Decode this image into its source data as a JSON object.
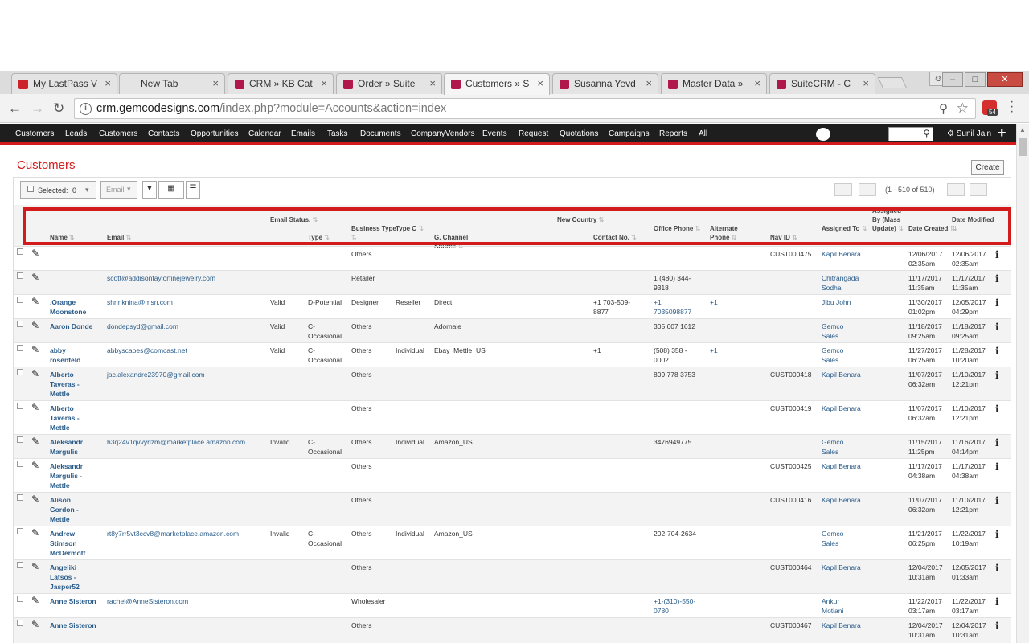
{
  "browser": {
    "tabs": [
      {
        "title": "My LastPass V",
        "fav": "lp",
        "active": false
      },
      {
        "title": "New Tab",
        "fav": "blank",
        "active": false
      },
      {
        "title": "CRM » KB Cat",
        "fav": "suite",
        "active": false
      },
      {
        "title": "Order » Suite",
        "fav": "suite",
        "active": false
      },
      {
        "title": "Customers » S",
        "fav": "suite",
        "active": true
      },
      {
        "title": "Susanna Yevd",
        "fav": "suite",
        "active": false
      },
      {
        "title": "Master Data »",
        "fav": "suite",
        "active": false
      },
      {
        "title": "SuiteCRM - C",
        "fav": "suite",
        "active": false
      }
    ],
    "url_host": "crm.gemcodesigns.com",
    "url_path": "/index.php?module=Accounts&action=index",
    "ext_badge": "54"
  },
  "nav": {
    "items": [
      "Customers",
      "Leads",
      "Customers",
      "Contacts",
      "Opportunities",
      "Calendar",
      "Emails",
      "Tasks",
      "Documents",
      "CompanyVendors",
      "Events",
      "Request",
      "Quotations",
      "Campaigns",
      "Reports",
      "All"
    ],
    "user": "Sunil Jain"
  },
  "page": {
    "title": "Customers",
    "create_label": "Create",
    "selected_label": "Selected:",
    "selected_count": "0",
    "email_label": "Email",
    "pagination": "(1 - 510 of 510)"
  },
  "columns": [
    "Name",
    "Email",
    "Email Status.",
    "Type",
    "Business Type",
    "Type C",
    "G. Channel Source",
    "New Country",
    "Contact No.",
    "Office Phone",
    "Alternate Phone",
    "Nav ID",
    "Assigned To",
    "Assigned By (Mass Update)",
    "Date Created",
    "Date Modified"
  ],
  "rows": [
    {
      "name": "",
      "email": "",
      "status": "",
      "type": "",
      "btype": "Others",
      "typec": "",
      "source": "",
      "country": "",
      "contact": "",
      "office": "",
      "alt": "",
      "navid": "CUST000475",
      "assigned": "Kapil Benara",
      "created": "12/06/2017\n02:35am",
      "modified": "12/06/2017\n02:35am"
    },
    {
      "name": "",
      "email": "scott@addisontaylorfinejewelry.com",
      "status": "",
      "type": "",
      "btype": "Retailer",
      "typec": "",
      "source": "",
      "country": "",
      "contact": "",
      "office": "1 (480) 344-\n9318",
      "alt": "",
      "navid": "",
      "assigned": "Chitrangada\nSodha",
      "created": "11/17/2017\n11:35am",
      "modified": "11/17/2017\n11:35am"
    },
    {
      "name": ".Orange\nMoonstone",
      "email": "shrinknina@msn.com",
      "status": "Valid",
      "type": "D-Potential",
      "btype": "Designer",
      "typec": "Reseller",
      "source": "Direct",
      "country": "",
      "contact": "+1 703-509-\n8877",
      "office": "+1\n7035098877",
      "alt": "+1",
      "navid": "",
      "assigned": "Jibu John",
      "created": "11/30/2017\n01:02pm",
      "modified": "12/05/2017\n04:29pm"
    },
    {
      "name": "Aaron Donde",
      "email": "dondepsyd@gmail.com",
      "status": "Valid",
      "type": "C-\nOccasional",
      "btype": "Others",
      "typec": "",
      "source": "Adornale",
      "country": "",
      "contact": "",
      "office": "305 607 1612",
      "alt": "",
      "navid": "",
      "assigned": "Gemco\nSales",
      "created": "11/18/2017\n09:25am",
      "modified": "11/18/2017\n09:25am"
    },
    {
      "name": "abby\nrosenfeld",
      "email": "abbyscapes@comcast.net",
      "status": "Valid",
      "type": "C-\nOccasional",
      "btype": "Others",
      "typec": "Individual",
      "source": "Ebay_Mettle_US",
      "country": "",
      "contact": "+1",
      "office": "(508) 358 -\n0002",
      "alt": "+1",
      "navid": "",
      "assigned": "Gemco\nSales",
      "created": "11/27/2017\n06:25am",
      "modified": "11/28/2017\n10:20am"
    },
    {
      "name": "Alberto\nTaveras -\nMettle",
      "email": "jac.alexandre23970@gmail.com",
      "status": "",
      "type": "",
      "btype": "Others",
      "typec": "",
      "source": "",
      "country": "",
      "contact": "",
      "office": "809 778 3753",
      "alt": "",
      "navid": "CUST000418",
      "assigned": "Kapil Benara",
      "created": "11/07/2017\n06:32am",
      "modified": "11/10/2017\n12:21pm"
    },
    {
      "name": "Alberto\nTaveras -\nMettle",
      "email": "",
      "status": "",
      "type": "",
      "btype": "Others",
      "typec": "",
      "source": "",
      "country": "",
      "contact": "",
      "office": "",
      "alt": "",
      "navid": "CUST000419",
      "assigned": "Kapil Benara",
      "created": "11/07/2017\n06:32am",
      "modified": "11/10/2017\n12:21pm"
    },
    {
      "name": "Aleksandr\nMargulis",
      "email": "h3q24v1qvvyrlzm@marketplace.amazon.com",
      "status": "Invalid",
      "type": "C-\nOccasional",
      "btype": "Others",
      "typec": "Individual",
      "source": "Amazon_US",
      "country": "",
      "contact": "",
      "office": "3476949775",
      "alt": "",
      "navid": "",
      "assigned": "Gemco\nSales",
      "created": "11/15/2017\n11:25pm",
      "modified": "11/16/2017\n04:14pm"
    },
    {
      "name": "Aleksandr\nMargulis -\nMettle",
      "email": "",
      "status": "",
      "type": "",
      "btype": "Others",
      "typec": "",
      "source": "",
      "country": "",
      "contact": "",
      "office": "",
      "alt": "",
      "navid": "CUST000425",
      "assigned": "Kapil Benara",
      "created": "11/17/2017\n04:38am",
      "modified": "11/17/2017\n04:38am"
    },
    {
      "name": "Alison\nGordon -\nMettle",
      "email": "",
      "status": "",
      "type": "",
      "btype": "Others",
      "typec": "",
      "source": "",
      "country": "",
      "contact": "",
      "office": "",
      "alt": "",
      "navid": "CUST000416",
      "assigned": "Kapil Benara",
      "created": "11/07/2017\n06:32am",
      "modified": "11/10/2017\n12:21pm"
    },
    {
      "name": "Andrew\nStimson\nMcDermott",
      "email": "rt8y7rr5vt3ccv8@marketplace.amazon.com",
      "status": "Invalid",
      "type": "C-\nOccasional",
      "btype": "Others",
      "typec": "Individual",
      "source": "Amazon_US",
      "country": "",
      "contact": "",
      "office": "202-704-2634",
      "alt": "",
      "navid": "",
      "assigned": "Gemco\nSales",
      "created": "11/21/2017\n06:25pm",
      "modified": "11/22/2017\n10:19am"
    },
    {
      "name": "Angeliki\nLatsos -\nJasper52",
      "email": "",
      "status": "",
      "type": "",
      "btype": "Others",
      "typec": "",
      "source": "",
      "country": "",
      "contact": "",
      "office": "",
      "alt": "",
      "navid": "CUST000464",
      "assigned": "Kapil Benara",
      "created": "12/04/2017\n10:31am",
      "modified": "12/05/2017\n01:33am"
    },
    {
      "name": "Anne Sisteron",
      "email": "rachel@AnneSisteron.com",
      "status": "",
      "type": "",
      "btype": "Wholesaler",
      "typec": "",
      "source": "",
      "country": "",
      "contact": "",
      "office": "+1-(310)-550-\n0780",
      "alt": "",
      "navid": "",
      "assigned": "Ankur\nMotiani",
      "created": "11/22/2017\n03:17am",
      "modified": "11/22/2017\n03:17am"
    },
    {
      "name": "Anne Sisteron",
      "email": "",
      "status": "",
      "type": "",
      "btype": "Others",
      "typec": "",
      "source": "",
      "country": "",
      "contact": "",
      "office": "",
      "alt": "",
      "navid": "CUST000467",
      "assigned": "Kapil Benara",
      "created": "12/04/2017\n10:31am",
      "modified": "12/04/2017\n10:31am"
    }
  ]
}
